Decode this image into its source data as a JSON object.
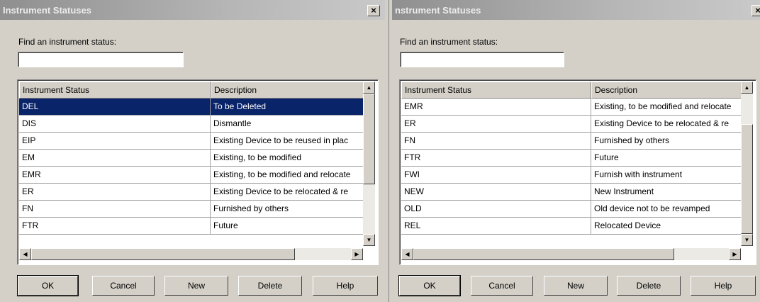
{
  "left_dialog": {
    "title": "Instrument Statuses",
    "close_glyph": "×",
    "find_label": "Find an instrument status:",
    "find_value": "",
    "columns": [
      "Instrument Status",
      "Description"
    ],
    "rows": [
      {
        "status": "DEL",
        "description": "To be Deleted",
        "selected": true
      },
      {
        "status": "DIS",
        "description": "Dismantle"
      },
      {
        "status": "EIP",
        "description": "Existing Device to be reused in plac"
      },
      {
        "status": "EM",
        "description": "Existing, to be modified"
      },
      {
        "status": "EMR",
        "description": "Existing, to be modified and relocate"
      },
      {
        "status": "ER",
        "description": "Existing Device to be relocated & re"
      },
      {
        "status": "FN",
        "description": "Furnished by others"
      },
      {
        "status": "FTR",
        "description": "Future"
      }
    ],
    "buttons": {
      "ok": "OK",
      "cancel": "Cancel",
      "new": "New",
      "delete": "Delete",
      "help": "Help"
    }
  },
  "right_dialog": {
    "title": "nstrument Statuses",
    "close_glyph": "×",
    "find_label": "Find an instrument status:",
    "find_value": "",
    "columns": [
      "Instrument Status",
      "Description"
    ],
    "rows": [
      {
        "status": "EMR",
        "description": "Existing, to be modified and relocate"
      },
      {
        "status": "ER",
        "description": "Existing Device to be relocated & re"
      },
      {
        "status": "FN",
        "description": "Furnished by others"
      },
      {
        "status": "FTR",
        "description": "Future"
      },
      {
        "status": "FWI",
        "description": "Furnish with instrument"
      },
      {
        "status": "NEW",
        "description": "New Instrument"
      },
      {
        "status": "OLD",
        "description": "Old device not to be revamped"
      },
      {
        "status": "REL",
        "description": "Relocated Device"
      }
    ],
    "buttons": {
      "ok": "OK",
      "cancel": "Cancel",
      "new": "New",
      "delete": "Delete",
      "help": "Help"
    }
  },
  "icons": {
    "scroll_up": "▲",
    "scroll_down": "▼",
    "scroll_left": "◀",
    "scroll_right": "▶"
  },
  "colors": {
    "selection": "#0a246a",
    "face": "#d4d0c8"
  }
}
